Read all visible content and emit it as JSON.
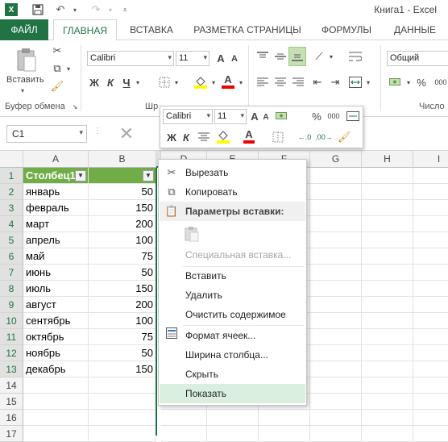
{
  "window": {
    "title": "Книга1 - Excel"
  },
  "tabs": [
    "ФАЙЛ",
    "ГЛАВНАЯ",
    "ВСТАВКА",
    "РАЗМЕТКА СТРАНИЦЫ",
    "ФОРМУЛЫ",
    "ДАННЫЕ"
  ],
  "ribbon": {
    "paste_label": "Вставить",
    "font_name": "Calibri",
    "font_size": "11",
    "bold": "Ж",
    "italic": "К",
    "underline": "Ч",
    "grow_font": "A",
    "shrink_font": "A",
    "number_format": "Общий",
    "clipboard_group": "Буфер обмена",
    "font_group_partial": "Шр",
    "number_group": "Число",
    "percent": "%",
    "comma": "000"
  },
  "mini_toolbar": {
    "font_name": "Calibri",
    "font_size": "11",
    "bold": "Ж",
    "italic": "К",
    "percent": "%",
    "comma": "000"
  },
  "name_box": "C1",
  "columns": [
    "A",
    "B",
    "C",
    "D",
    "E",
    "F",
    "G",
    "H",
    "I"
  ],
  "rows": [
    "1",
    "2",
    "3",
    "4",
    "5",
    "6",
    "7",
    "8",
    "9",
    "10",
    "11",
    "12",
    "13",
    "14",
    "15",
    "16",
    "17"
  ],
  "table": {
    "header": [
      "Столбец1",
      ""
    ],
    "data": [
      [
        "январь",
        "50"
      ],
      [
        "февраль",
        "150"
      ],
      [
        "март",
        "200"
      ],
      [
        "апрель",
        "100"
      ],
      [
        "май",
        "75"
      ],
      [
        "июнь",
        "50"
      ],
      [
        "июль",
        "150"
      ],
      [
        "август",
        "200"
      ],
      [
        "сентябрь",
        "100"
      ],
      [
        "октябрь",
        "75"
      ],
      [
        "ноябрь",
        "50"
      ],
      [
        "декабрь",
        "150"
      ]
    ]
  },
  "context_menu": {
    "cut": "Вырезать",
    "copy": "Копировать",
    "paste_options": "Параметры вставки:",
    "paste_special": "Специальная вставка...",
    "insert": "Вставить",
    "delete": "Удалить",
    "clear": "Очистить содержимое",
    "format_cells": "Формат ячеек...",
    "column_width": "Ширина столбца...",
    "hide": "Скрыть",
    "unhide": "Показать"
  },
  "colors": {
    "accent": "#217346",
    "table_header": "#70ad47",
    "menu_hover": "#dbefe0"
  }
}
